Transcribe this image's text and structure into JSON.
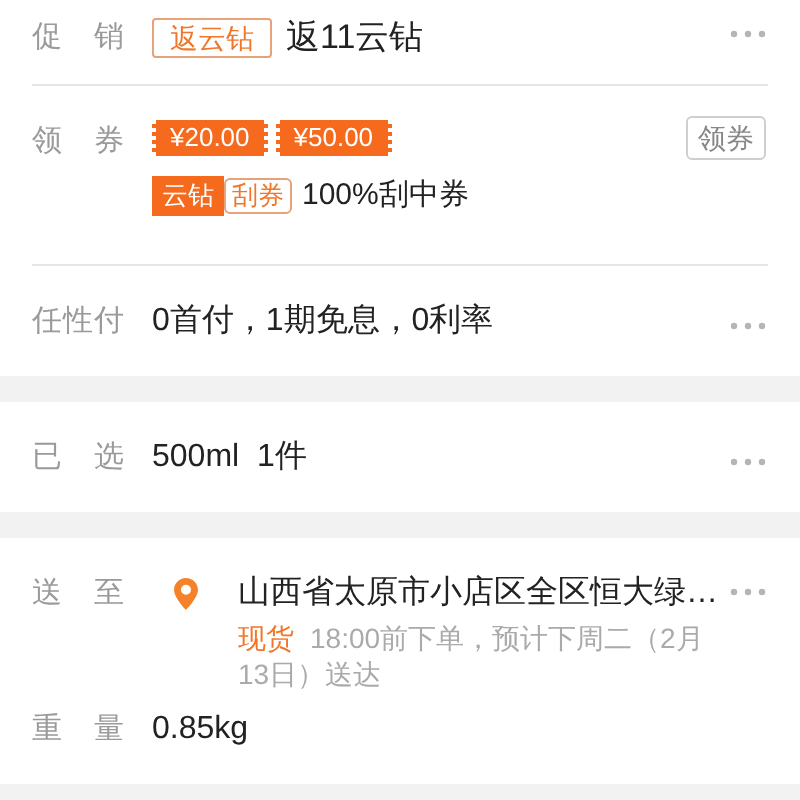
{
  "sections": [
    {
      "rows": [
        {
          "kind": "promo",
          "label": "促销",
          "tag": "返云钻",
          "text": "返11云钻",
          "more": true
        },
        {
          "kind": "coupon",
          "label": "领券",
          "coupons": [
            "¥20.00",
            "¥50.00"
          ],
          "button": "领券",
          "tags": [
            {
              "text": "云钻",
              "filled": true
            },
            {
              "text": "刮券",
              "filled": false
            }
          ],
          "text": "100%刮中券"
        },
        {
          "kind": "text",
          "label": "任性付",
          "text": "0首付，1期免息，0利率",
          "more": true
        }
      ]
    },
    {
      "rows": [
        {
          "kind": "text",
          "label": "已选",
          "text": "500ml  1件",
          "more": true
        }
      ]
    },
    {
      "rows": [
        {
          "kind": "delivery",
          "label": "送至",
          "address": "山西省太原市小店区全区恒大绿…",
          "stock": "现货",
          "text": "18:00前下单，预计下周二（2月13日）送达",
          "more": true
        },
        {
          "kind": "text",
          "label": "重量",
          "text": "0.85kg",
          "more": false
        }
      ]
    }
  ]
}
